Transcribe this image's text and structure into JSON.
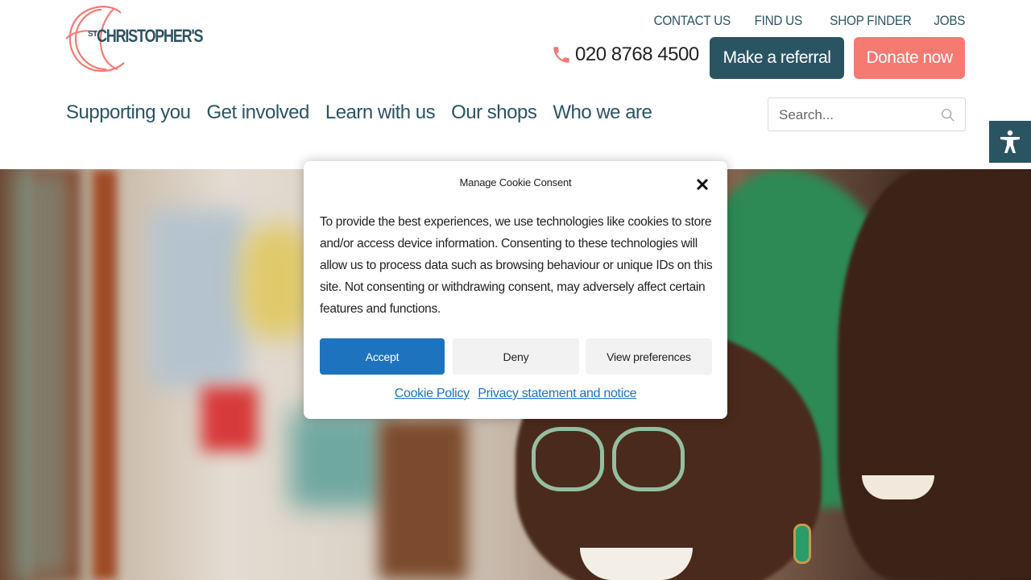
{
  "logo": {
    "st": "ST",
    "name": "CHRISTOPHER'S"
  },
  "top_links": [
    "CONTACT US",
    "FIND US",
    "SHOP FINDER",
    "JOBS"
  ],
  "phone": "020 8768 4500",
  "buttons": {
    "referral": "Make a referral",
    "donate": "Donate now"
  },
  "main_nav": [
    "Supporting you",
    "Get involved",
    "Learn with us",
    "Our shops",
    "Who we are"
  ],
  "search": {
    "placeholder": "Search..."
  },
  "cookie_modal": {
    "title": "Manage Cookie Consent",
    "body": "To provide the best experiences, we use technologies like cookies to store and/or access device information. Consenting to these technologies will allow us to process data such as browsing behaviour or unique IDs on this site. Not consenting or withdrawing consent, may adversely affect certain features and functions.",
    "accept": "Accept",
    "deny": "Deny",
    "view_preferences": "View preferences",
    "cookie_policy": "Cookie Policy",
    "privacy": "Privacy statement and notice"
  },
  "colors": {
    "brand_teal": "#2b5463",
    "brand_coral": "#f57a72",
    "accept_blue": "#1e73be"
  },
  "icons": [
    "phone-icon",
    "search-icon",
    "accessibility-icon",
    "close-icon"
  ]
}
